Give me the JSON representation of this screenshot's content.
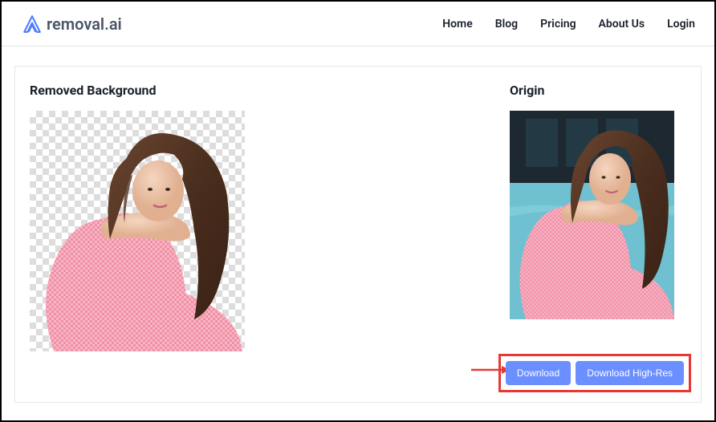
{
  "header": {
    "logo_text": "removal.ai",
    "nav_items": [
      {
        "label": "Home",
        "name": "nav-home"
      },
      {
        "label": "Blog",
        "name": "nav-blog"
      },
      {
        "label": "Pricing",
        "name": "nav-pricing"
      },
      {
        "label": "About Us",
        "name": "nav-about"
      },
      {
        "label": "Login",
        "name": "nav-login"
      }
    ]
  },
  "main": {
    "removed_title": "Removed Background",
    "origin_title": "Origin"
  },
  "buttons": {
    "download": "Download",
    "download_hires": "Download High-Res"
  },
  "colors": {
    "accent_blue": "#6b8fff",
    "highlight_red": "#e53935",
    "logo_blue": "#4d7cff"
  }
}
